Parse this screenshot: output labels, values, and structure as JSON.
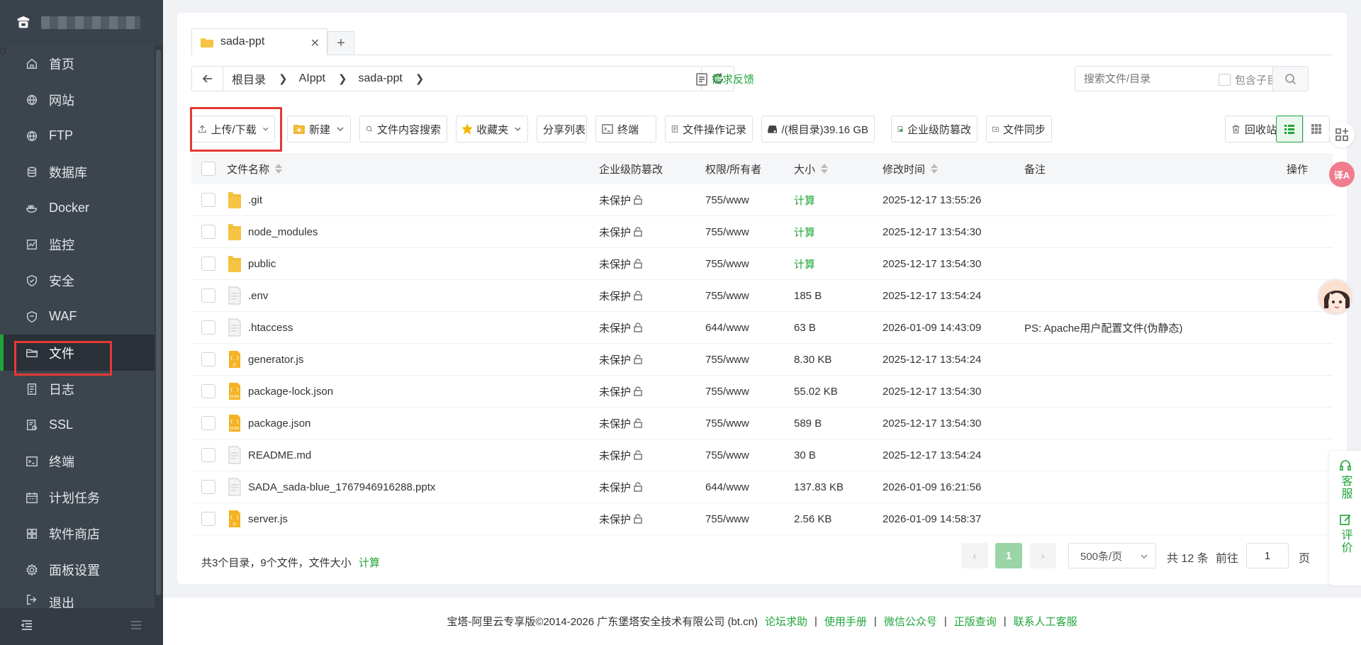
{
  "sidebar": {
    "items": [
      {
        "label": "首页",
        "icon": "home-icon"
      },
      {
        "label": "网站",
        "icon": "globe-icon"
      },
      {
        "label": "FTP",
        "icon": "globe-icon"
      },
      {
        "label": "数据库",
        "icon": "database-icon"
      },
      {
        "label": "Docker",
        "icon": "docker-icon"
      },
      {
        "label": "监控",
        "icon": "monitor-icon"
      },
      {
        "label": "安全",
        "icon": "shield-icon"
      },
      {
        "label": "WAF",
        "icon": "waf-shield-icon"
      },
      {
        "label": "文件",
        "icon": "folder-icon",
        "active": true
      },
      {
        "label": "日志",
        "icon": "log-icon"
      },
      {
        "label": "SSL",
        "icon": "ssl-icon"
      },
      {
        "label": "终端",
        "icon": "terminal-icon"
      },
      {
        "label": "计划任务",
        "icon": "calendar-icon"
      },
      {
        "label": "软件商店",
        "icon": "apps-icon"
      },
      {
        "label": "面板设置",
        "icon": "gear-icon"
      },
      {
        "label": "退出",
        "icon": "logout-icon"
      }
    ],
    "badge": "0"
  },
  "tabs": [
    {
      "label": "sada-ppt"
    }
  ],
  "tab_add": "+",
  "breadcrumb": [
    "根目录",
    "AIppt",
    "sada-ppt"
  ],
  "feedback_label": "需求反馈",
  "search": {
    "placeholder": "搜索文件/目录",
    "subdir_label": "包含子目录"
  },
  "toolbar": {
    "upload": "上传/下载",
    "new": "新建",
    "content_search": "文件内容搜索",
    "favorites": "收藏夹",
    "share_list": "分享列表",
    "terminal": "终端",
    "op_log": "文件操作记录",
    "disk": "/(根目录)39.16 GB",
    "tamper": "企业级防篡改",
    "sync": "文件同步",
    "recycle": "回收站"
  },
  "table": {
    "headers": {
      "name": "文件名称",
      "tamper": "企业级防篡改",
      "perm": "权限/所有者",
      "size": "大小",
      "mtime": "修改时间",
      "note": "备注",
      "ops": "操作"
    },
    "rows": [
      {
        "name": ".git",
        "type": "folder",
        "tamper": "未保护",
        "perm": "755/www",
        "size": "计算",
        "size_link": true,
        "mtime": "2025-12-17 13:55:26",
        "note": ""
      },
      {
        "name": "node_modules",
        "type": "folder",
        "tamper": "未保护",
        "perm": "755/www",
        "size": "计算",
        "size_link": true,
        "mtime": "2025-12-17 13:54:30",
        "note": ""
      },
      {
        "name": "public",
        "type": "folder",
        "tamper": "未保护",
        "perm": "755/www",
        "size": "计算",
        "size_link": true,
        "mtime": "2025-12-17 13:54:30",
        "note": ""
      },
      {
        "name": ".env",
        "type": "file",
        "tamper": "未保护",
        "perm": "755/www",
        "size": "185 B",
        "mtime": "2025-12-17 13:54:24",
        "note": ""
      },
      {
        "name": ".htaccess",
        "type": "file",
        "tamper": "未保护",
        "perm": "644/www",
        "size": "63 B",
        "mtime": "2026-01-09 14:43:09",
        "note": "PS: Apache用户配置文件(伪静态)"
      },
      {
        "name": "generator.js",
        "type": "js",
        "tamper": "未保护",
        "perm": "755/www",
        "size": "8.30 KB",
        "mtime": "2025-12-17 13:54:24",
        "note": ""
      },
      {
        "name": "package-lock.json",
        "type": "json",
        "tamper": "未保护",
        "perm": "755/www",
        "size": "55.02 KB",
        "mtime": "2025-12-17 13:54:30",
        "note": ""
      },
      {
        "name": "package.json",
        "type": "json",
        "tamper": "未保护",
        "perm": "755/www",
        "size": "589 B",
        "mtime": "2025-12-17 13:54:30",
        "note": ""
      },
      {
        "name": "README.md",
        "type": "file",
        "tamper": "未保护",
        "perm": "755/www",
        "size": "30 B",
        "mtime": "2025-12-17 13:54:24",
        "note": ""
      },
      {
        "name": "SADA_sada-blue_1767946916288.pptx",
        "type": "file",
        "tamper": "未保护",
        "perm": "644/www",
        "size": "137.83 KB",
        "mtime": "2026-01-09 16:21:56",
        "note": ""
      },
      {
        "name": "server.js",
        "type": "js",
        "tamper": "未保护",
        "perm": "755/www",
        "size": "2.56 KB",
        "mtime": "2026-01-09 14:58:37",
        "note": ""
      }
    ]
  },
  "summary": {
    "text": "共3个目录，9个文件，文件大小",
    "calc": "计算"
  },
  "pager": {
    "current": "1",
    "per_page": "500条/页",
    "total": "共 12 条",
    "goto_label": "前往",
    "goto_value": "1",
    "page_unit": "页",
    "prev": "‹",
    "next": "›"
  },
  "footer": {
    "copyright": "宝塔-阿里云专享版©2014-2026 广东堡塔安全技术有限公司 (bt.cn)",
    "links": [
      "论坛求助",
      "使用手册",
      "微信公众号",
      "正版查询",
      "联系人工客服"
    ],
    "sep": "|"
  },
  "side_tools": [
    {
      "label": "客服",
      "icon": "headset-icon"
    },
    {
      "label": "评价",
      "icon": "edit-icon"
    }
  ],
  "translate_label": "译A",
  "colors": {
    "accent": "#20a53a",
    "sidebar": "#3c444d",
    "highlight": "#e53935"
  }
}
